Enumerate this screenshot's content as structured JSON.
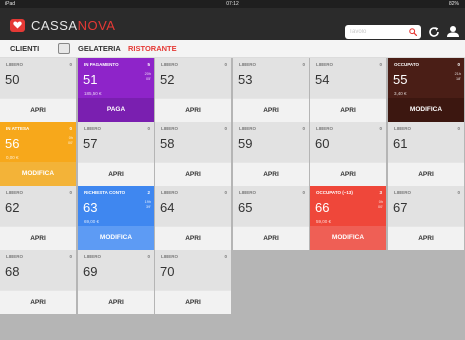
{
  "status_bar": {
    "device": "iPad",
    "time": "07:12",
    "battery": "82%"
  },
  "header": {
    "brand_prefix": "CASSA",
    "brand_suffix": "NOVA",
    "search_placeholder": "Tavolo",
    "accent_color": "#e53935"
  },
  "tabs": [
    {
      "label": "CLIENTI",
      "active": false
    },
    {
      "label": "GELATERIA",
      "active": false
    },
    {
      "label": "RISTORANTE",
      "active": true
    }
  ],
  "tables": [
    {
      "number": "50",
      "status": "LIBERO",
      "count": "0",
      "action": "APRI",
      "amount": "",
      "time": "",
      "color": "free"
    },
    {
      "number": "51",
      "status": "IN PAGAMENTO",
      "count": "5",
      "action": "PAGA",
      "amount": "185,50 €",
      "time": "20h\n05'",
      "color": "purple"
    },
    {
      "number": "52",
      "status": "LIBERO",
      "count": "0",
      "action": "APRI",
      "amount": "",
      "time": "",
      "color": "free"
    },
    {
      "number": "53",
      "status": "LIBERO",
      "count": "0",
      "action": "APRI",
      "amount": "",
      "time": "",
      "color": "free"
    },
    {
      "number": "54",
      "status": "LIBERO",
      "count": "0",
      "action": "APRI",
      "amount": "",
      "time": "",
      "color": "free"
    },
    {
      "number": "55",
      "status": "OCCUPATO",
      "count": "0",
      "action": "MODIFICA",
      "amount": "3,40 €",
      "time": "21h\n18'",
      "color": "brown"
    },
    {
      "number": "56",
      "status": "IN ATTESA",
      "count": "0",
      "action": "MODIFICA",
      "amount": "0,00 €",
      "time": "0h\n00'",
      "color": "orange"
    },
    {
      "number": "57",
      "status": "LIBERO",
      "count": "0",
      "action": "APRI",
      "amount": "",
      "time": "",
      "color": "free"
    },
    {
      "number": "58",
      "status": "LIBERO",
      "count": "0",
      "action": "APRI",
      "amount": "",
      "time": "",
      "color": "free"
    },
    {
      "number": "59",
      "status": "LIBERO",
      "count": "0",
      "action": "APRI",
      "amount": "",
      "time": "",
      "color": "free"
    },
    {
      "number": "60",
      "status": "LIBERO",
      "count": "0",
      "action": "APRI",
      "amount": "",
      "time": "",
      "color": "free"
    },
    {
      "number": "61",
      "status": "LIBERO",
      "count": "0",
      "action": "APRI",
      "amount": "",
      "time": "",
      "color": "free"
    },
    {
      "number": "62",
      "status": "LIBERO",
      "count": "0",
      "action": "APRI",
      "amount": "",
      "time": "",
      "color": "free"
    },
    {
      "number": "63",
      "status": "RICHIESTA CONTO",
      "count": "2",
      "action": "MODIFICA",
      "amount": "69,00 €",
      "time": "19h\n39'",
      "color": "blue"
    },
    {
      "number": "64",
      "status": "LIBERO",
      "count": "0",
      "action": "APRI",
      "amount": "",
      "time": "",
      "color": "free"
    },
    {
      "number": "65",
      "status": "LIBERO",
      "count": "0",
      "action": "APRI",
      "amount": "",
      "time": "",
      "color": "free"
    },
    {
      "number": "66",
      "status": "OCCUPATO (~13)",
      "count": "3",
      "action": "MODIFICA",
      "amount": "59,00 €",
      "time": "0h\n00'",
      "color": "red"
    },
    {
      "number": "67",
      "status": "LIBERO",
      "count": "0",
      "action": "APRI",
      "amount": "",
      "time": "",
      "color": "free"
    },
    {
      "number": "68",
      "status": "LIBERO",
      "count": "0",
      "action": "APRI",
      "amount": "",
      "time": "",
      "color": "free"
    },
    {
      "number": "69",
      "status": "LIBERO",
      "count": "0",
      "action": "APRI",
      "amount": "",
      "time": "",
      "color": "free"
    },
    {
      "number": "70",
      "status": "LIBERO",
      "count": "0",
      "action": "APRI",
      "amount": "",
      "time": "",
      "color": "free"
    }
  ],
  "colors": {
    "purple": "#8e24c9",
    "brown": "#4a1e16",
    "orange": "#f7a81b",
    "blue": "#3f87f0",
    "red": "#ef473a",
    "free": "#e2e2e2"
  }
}
